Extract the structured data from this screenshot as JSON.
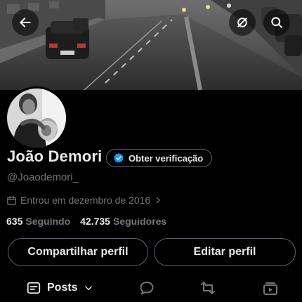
{
  "header": {
    "back_icon": "arrow-left-icon",
    "grok_icon": "slashed-circle-icon",
    "search_icon": "search-icon"
  },
  "profile": {
    "display_name": "João Demori",
    "verify_label": "Obter verificação",
    "handle": "@Joaodemori_",
    "joined_text": "Entrou em dezembro de 2016",
    "following_count": "635",
    "following_label": "Seguindo",
    "followers_count": "42.735",
    "followers_label": "Seguidores"
  },
  "actions": {
    "share_label": "Compartilhar perfil",
    "edit_label": "Editar perfil"
  },
  "tabs": {
    "posts_label": "Posts"
  },
  "colors": {
    "background": "#000000",
    "text_primary": "#e7e9ea",
    "text_secondary": "#71767b",
    "border": "#536471",
    "verified_blue": "#1d9bf0"
  }
}
